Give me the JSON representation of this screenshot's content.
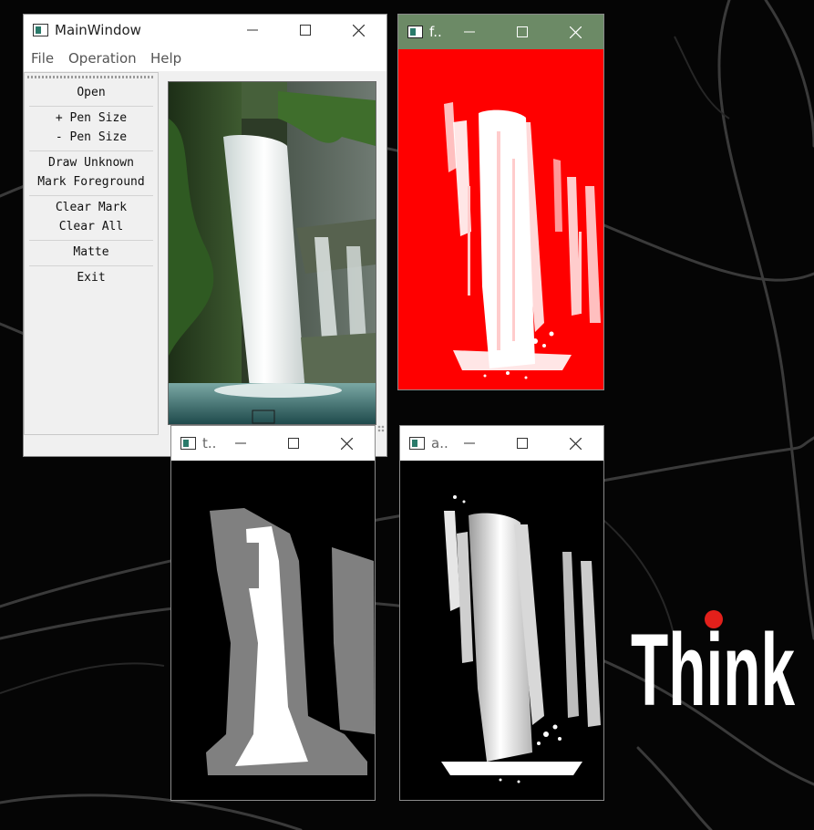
{
  "desktop": {
    "logo_text": "Think",
    "logo_colors": {
      "text": "#ffffff",
      "dot": "#e3201b"
    }
  },
  "main_window": {
    "title": "MainWindow",
    "menu": [
      "File",
      "Operation",
      "Help"
    ],
    "buttons": {
      "open": "Open",
      "pen_size_up": "+ Pen Size",
      "pen_size_down": "- Pen Size",
      "draw_unknown": "Draw Unknown",
      "mark_foreground": "Mark Foreground",
      "clear_mark": "Clear Mark",
      "clear_all": "Clear All",
      "matte": "Matte",
      "exit": "Exit"
    }
  },
  "foreground_window": {
    "title": "f..",
    "titlebar_color": "#6c8a66",
    "background_color": "#ff0000"
  },
  "trimap_window": {
    "title": "t.."
  },
  "alpha_window": {
    "title": "a.."
  },
  "colors": {
    "accent_window_frame": "#6c8a66"
  },
  "icons": [
    "app-icon",
    "minimize-icon",
    "maximize-icon",
    "close-icon"
  ]
}
